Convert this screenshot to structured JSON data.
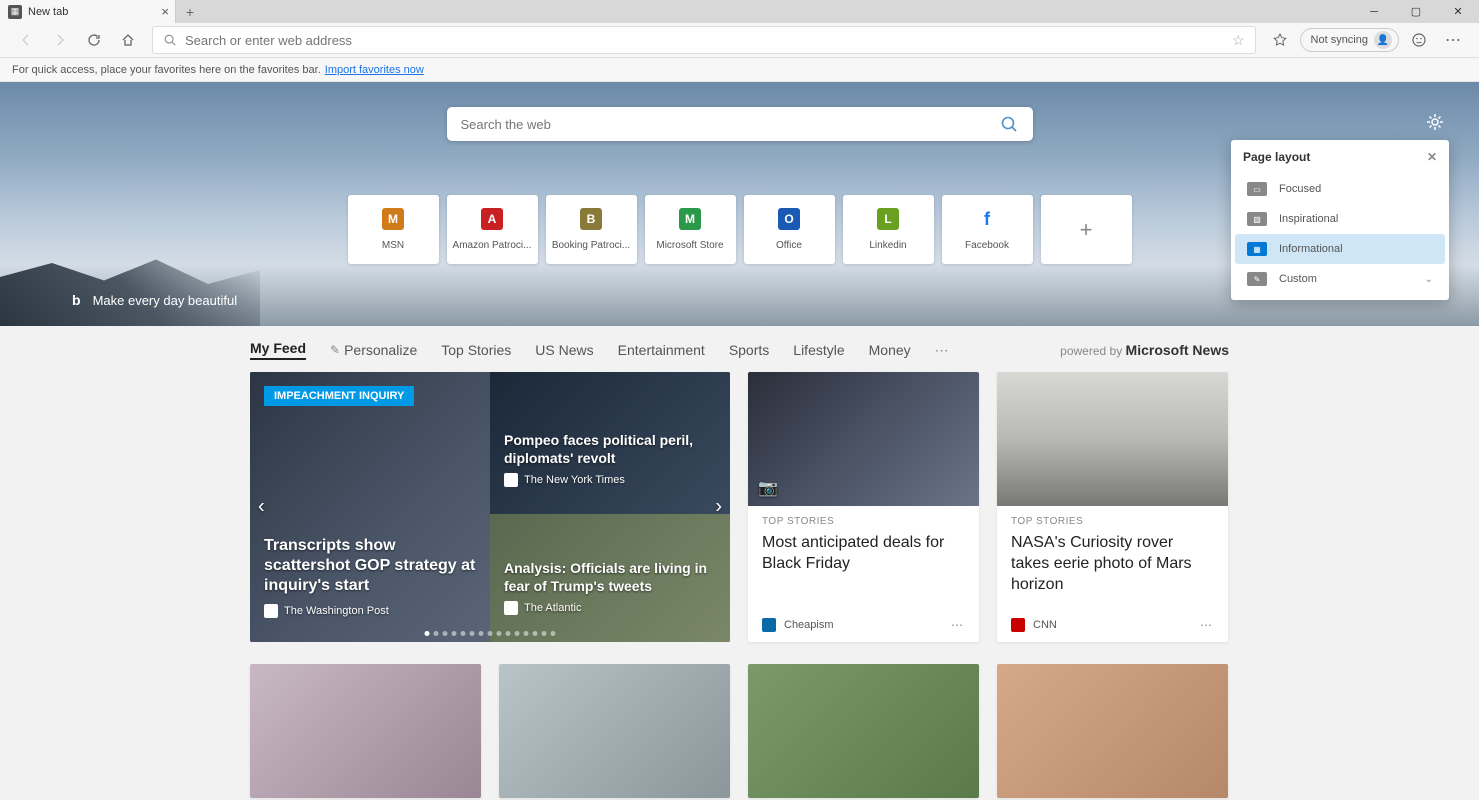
{
  "tab": {
    "title": "New tab"
  },
  "addressbar": {
    "placeholder": "Search or enter web address"
  },
  "sync": {
    "label": "Not syncing"
  },
  "favbar": {
    "hint": "For quick access, place your favorites here on the favorites bar.",
    "link": "Import favorites now"
  },
  "websearch": {
    "placeholder": "Search the web"
  },
  "quicklinks": [
    {
      "letter": "M",
      "color": "#d07a1a",
      "label": "MSN"
    },
    {
      "letter": "A",
      "color": "#c82020",
      "label": "Amazon Patroci..."
    },
    {
      "letter": "B",
      "color": "#8a7a3a",
      "label": "Booking Patroci..."
    },
    {
      "letter": "M",
      "color": "#2a9a4a",
      "label": "Microsoft Store"
    },
    {
      "letter": "O",
      "color": "#1a5ab4",
      "label": "Office"
    },
    {
      "letter": "L",
      "color": "#6aa020",
      "label": "Linkedin"
    },
    {
      "letter": "f",
      "color": "#ffffff",
      "label": "Facebook"
    }
  ],
  "bing_promo": "Make every day beautiful",
  "layout_panel": {
    "title": "Page layout",
    "options": [
      "Focused",
      "Inspirational",
      "Informational",
      "Custom"
    ],
    "selected": "Informational"
  },
  "feed_nav": {
    "items": [
      "My Feed",
      "Personalize",
      "Top Stories",
      "US News",
      "Entertainment",
      "Sports",
      "Lifestyle",
      "Money"
    ],
    "active": "My Feed",
    "powered_prefix": "powered by ",
    "powered_name": "Microsoft News"
  },
  "hero_card": {
    "tag": "IMPEACHMENT INQUIRY",
    "left": {
      "headline": "Transcripts show scattershot GOP strategy at inquiry's start",
      "source": "The Washington Post"
    },
    "right_top": {
      "headline": "Pompeo faces political peril, diplomats' revolt",
      "source": "The New York Times"
    },
    "right_bot": {
      "headline": "Analysis: Officials are living in fear of Trump's tweets",
      "source": "The Atlantic"
    }
  },
  "cards": [
    {
      "category": "TOP STORIES",
      "title": "Most anticipated deals for Black Friday",
      "source": "Cheapism",
      "src_color": "#0a6aa8"
    },
    {
      "category": "TOP STORIES",
      "title": "NASA's Curiosity rover takes eerie photo of Mars horizon",
      "source": "CNN",
      "src_color": "#c80000"
    }
  ]
}
